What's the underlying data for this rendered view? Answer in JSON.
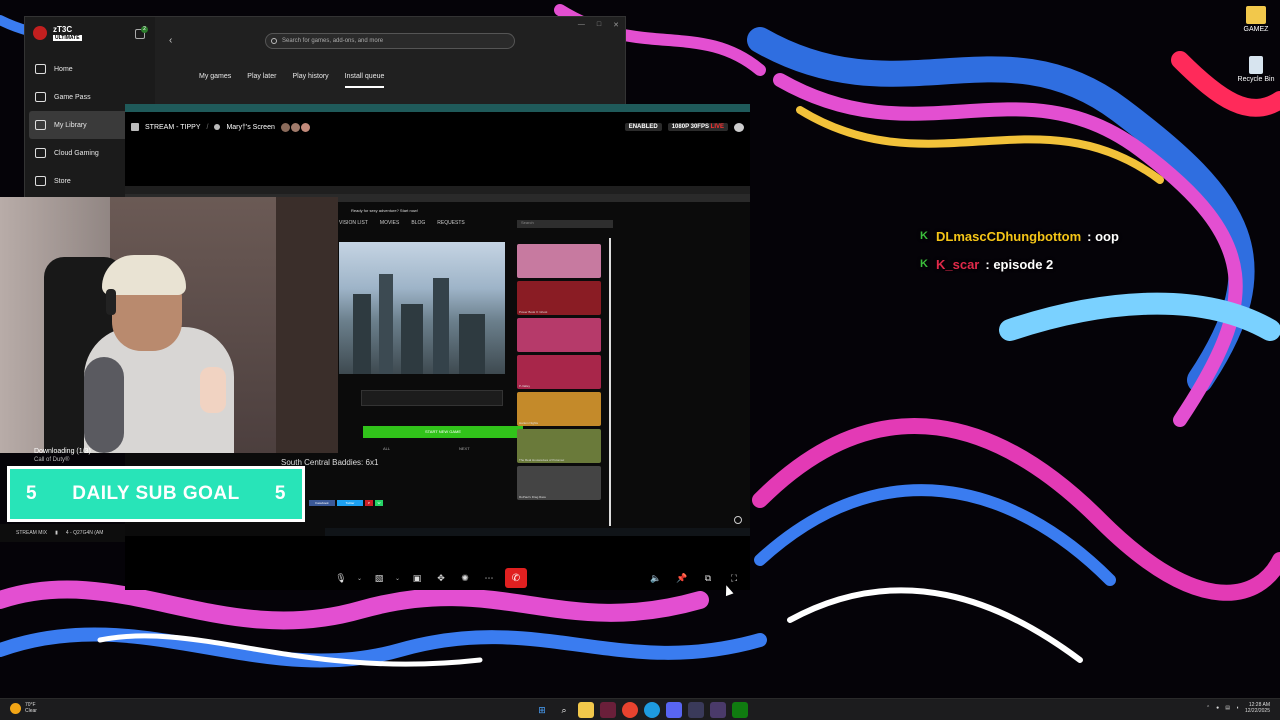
{
  "desktop": {
    "icons": [
      {
        "label": "GAMEZ",
        "icon": "folder-icon"
      },
      {
        "label": "Recycle Bin",
        "icon": "recycle-bin-icon"
      }
    ]
  },
  "xbox": {
    "profile": {
      "name": "zT3C",
      "badge": "ULTIMATE",
      "notifications": "2"
    },
    "nav": [
      {
        "label": "Home",
        "icon": "home-icon"
      },
      {
        "label": "Game Pass",
        "icon": "game-pass-icon"
      },
      {
        "label": "My Library",
        "icon": "library-icon",
        "active": true
      },
      {
        "label": "Cloud Gaming",
        "icon": "cloud-icon"
      },
      {
        "label": "Store",
        "icon": "store-icon"
      }
    ],
    "search_placeholder": "Search for games, add-ons, and more",
    "tabs": [
      {
        "label": "My games"
      },
      {
        "label": "Play later"
      },
      {
        "label": "Play history"
      },
      {
        "label": "Install queue",
        "active": true
      }
    ]
  },
  "stream": {
    "channel": "STREAM - TIPPY",
    "screen_owner": "Mary†'s Screen",
    "enabled_label": "ENABLED",
    "quality": "1080P 30FPS",
    "live_label": "LIVE",
    "shared_screen": {
      "site_nav": [
        "VISION LIST",
        "MOVIES",
        "BLOG",
        "REQUESTS"
      ],
      "search_placeholder": "Search",
      "tagline": "Ready for sexy adventure? Start now!",
      "start_button": "START NEW GAME",
      "start_left": "ALL",
      "start_right": "NEXT",
      "side_items": [
        {
          "label": "",
          "color": "#c77aa0"
        },
        {
          "label": "Power Book II: Ghost",
          "color": "#8a1c24"
        },
        {
          "label": "",
          "color": "#b63a6a"
        },
        {
          "label": "P-Valley",
          "color": "#a8264a"
        },
        {
          "label": "Harlem Nights",
          "color": "#c48a2a"
        },
        {
          "label": "The Real Housewives of Potomac",
          "color": "#6a7a3a"
        },
        {
          "label": "RuPaul's Drag Race",
          "color": "#444444"
        }
      ],
      "share_buttons": [
        {
          "label": "Facebook",
          "color": "#3b5998"
        },
        {
          "label": "Twitter",
          "color": "#1da1f2"
        },
        {
          "label": "P",
          "color": "#cb2027"
        },
        {
          "label": "W",
          "color": "#25d366"
        }
      ]
    }
  },
  "overlay": {
    "now_playing_line1": "Downloading (1/3)",
    "now_playing_line2": "Call of Duty®",
    "subgoal": {
      "left": "5",
      "title": "DAILY SUB GOAL",
      "right": "5",
      "color": "#28e4b8"
    },
    "stream_mix": "STREAM MIX",
    "stream_mix_source": "4 - Q27G4N (AM",
    "episode_title": "South Central Baddies: 6x1"
  },
  "chat": [
    {
      "user": "DLmascCDhungbottom",
      "message": ": oop",
      "color": "#f5c518"
    },
    {
      "user": "K_scar",
      "message": ": episode 2",
      "color": "#e0294a"
    }
  ],
  "taskbar": {
    "weather_temp": "70°F",
    "weather_desc": "Clear",
    "time": "12:28 AM",
    "date": "12/22/2025"
  }
}
